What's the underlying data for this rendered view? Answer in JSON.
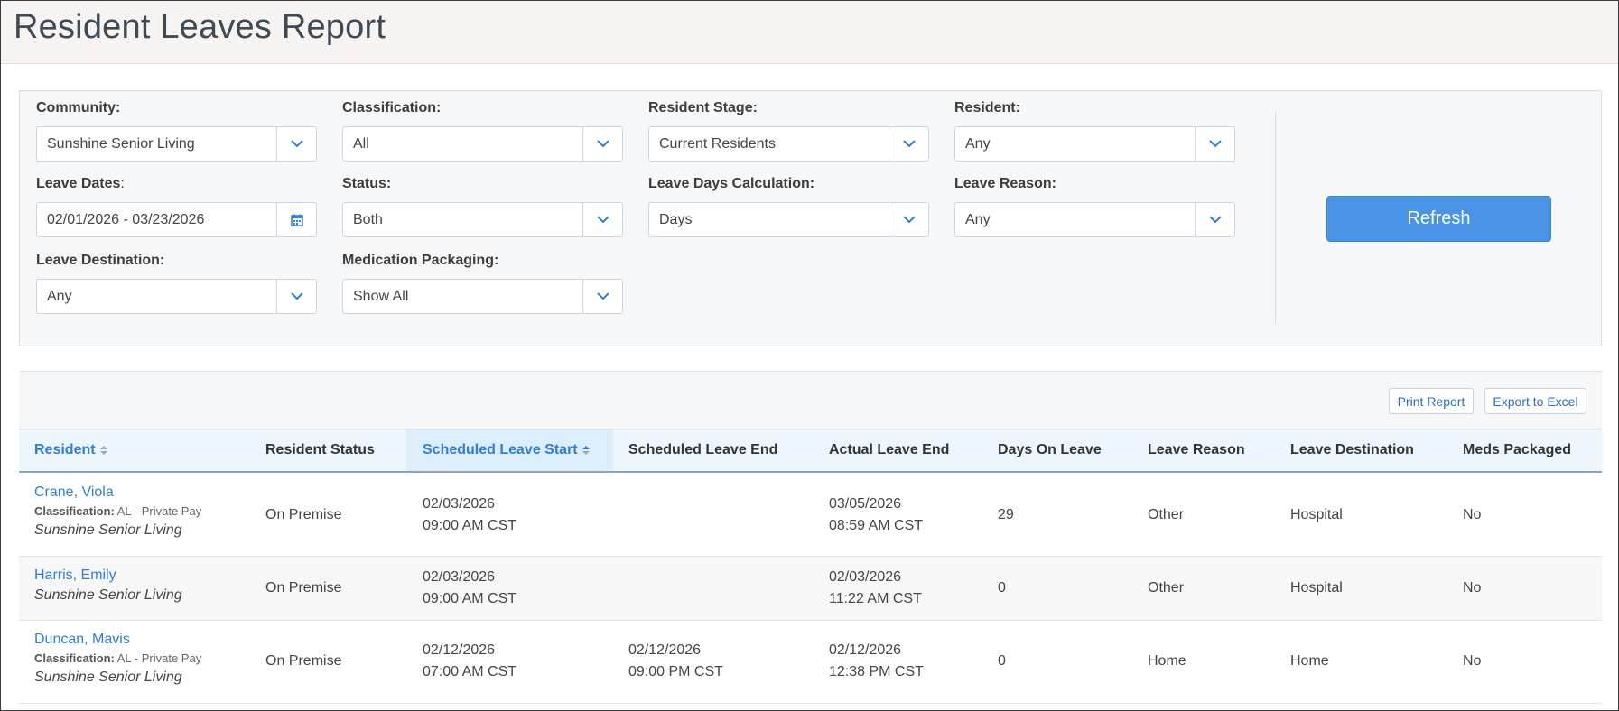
{
  "page": {
    "title": "Resident Leaves Report"
  },
  "colors": {
    "accent": "#4a94e8",
    "link": "#2f7fd6",
    "header_bg": "#f7f3f2"
  },
  "filters": {
    "community": {
      "label": "Community:",
      "value": "Sunshine Senior Living"
    },
    "classification": {
      "label": "Classification:",
      "value": "All"
    },
    "resident_stage": {
      "label": "Resident Stage:",
      "value": "Current Residents"
    },
    "resident": {
      "label": "Resident:",
      "value": "Any"
    },
    "leave_dates": {
      "label": "Leave Dates",
      "suffix": ":",
      "value": "02/01/2026 - 03/23/2026",
      "icon": "calendar-icon"
    },
    "status": {
      "label": "Status:",
      "value": "Both"
    },
    "leave_days_calc": {
      "label": "Leave Days Calculation:",
      "value": "Days"
    },
    "leave_reason": {
      "label": "Leave Reason:",
      "value": "Any"
    },
    "leave_destination": {
      "label": "Leave Destination:",
      "value": "Any"
    },
    "med_packaging": {
      "label": "Medication Packaging:",
      "value": "Show All"
    },
    "refresh_label": "Refresh"
  },
  "toolbar": {
    "print_label": "Print Report",
    "export_label": "Export to Excel"
  },
  "table": {
    "columns": [
      "Resident",
      "Resident Status",
      "Scheduled Leave Start",
      "Scheduled Leave End",
      "Actual Leave End",
      "Days On Leave",
      "Leave Reason",
      "Leave Destination",
      "Meds Packaged"
    ],
    "rows": [
      {
        "name": "Crane, Viola",
        "class_label": "Classification:",
        "class_value": "AL - Private Pay",
        "community": "Sunshine Senior Living",
        "status": "On Premise",
        "sched_start_date": "02/03/2026",
        "sched_start_time": "09:00 AM CST",
        "sched_end_date": "",
        "sched_end_time": "",
        "actual_end_date": "03/05/2026",
        "actual_end_time": "08:59 AM CST",
        "days": "29",
        "reason": "Other",
        "destination": "Hospital",
        "meds": "No"
      },
      {
        "name": "Harris, Emily",
        "class_label": "",
        "class_value": "",
        "community": "Sunshine Senior Living",
        "status": "On Premise",
        "sched_start_date": "02/03/2026",
        "sched_start_time": "09:00 AM CST",
        "sched_end_date": "",
        "sched_end_time": "",
        "actual_end_date": "02/03/2026",
        "actual_end_time": "11:22 AM CST",
        "days": "0",
        "reason": "Other",
        "destination": "Hospital",
        "meds": "No"
      },
      {
        "name": "Duncan, Mavis",
        "class_label": "Classification:",
        "class_value": "AL - Private Pay",
        "community": "Sunshine Senior Living",
        "status": "On Premise",
        "sched_start_date": "02/12/2026",
        "sched_start_time": "07:00 AM CST",
        "sched_end_date": "02/12/2026",
        "sched_end_time": "09:00 PM CST",
        "actual_end_date": "02/12/2026",
        "actual_end_time": "12:38 PM CST",
        "days": "0",
        "reason": "Home",
        "destination": "Home",
        "meds": "No"
      }
    ]
  }
}
